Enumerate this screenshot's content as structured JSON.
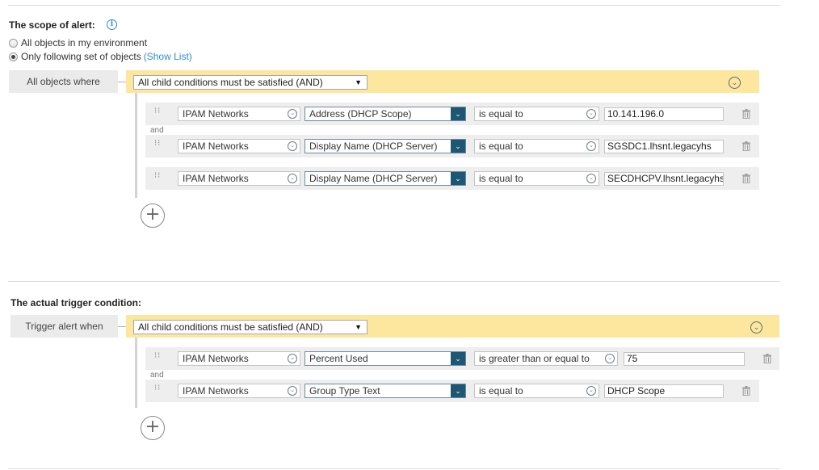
{
  "scope": {
    "heading": "The scope of alert:",
    "info_icon": "i",
    "radio_all": "All objects in my environment",
    "radio_following": "Only following set of objects",
    "show_list": "(Show List)",
    "label": "All objects where",
    "group_select": "All child conditions must be satisfied (AND)",
    "rows": [
      {
        "entity": "IPAM Networks",
        "field": "Address (DHCP Scope)",
        "operator": "is equal to",
        "value": "10.141.196.0"
      },
      {
        "entity": "IPAM Networks",
        "field": "Display Name (DHCP Server)",
        "operator": "is equal to",
        "value": "SGSDC1.lhsnt.legacyhs"
      },
      {
        "entity": "IPAM Networks",
        "field": "Display Name (DHCP Server)",
        "operator": "is equal to",
        "value": "SECDHCPV.lhsnt.legacyhs"
      }
    ],
    "and_label": "and"
  },
  "trigger": {
    "heading": "The actual trigger condition:",
    "label": "Trigger alert when",
    "group_select": "All child conditions must be satisfied (AND)",
    "rows": [
      {
        "entity": "IPAM Networks",
        "field": "Percent Used",
        "operator": "is greater than or equal to",
        "value": "75"
      },
      {
        "entity": "IPAM Networks",
        "field": "Group Type Text",
        "operator": "is equal to",
        "value": "DHCP Scope"
      }
    ],
    "and_label": "and"
  },
  "icons": {
    "add": "+",
    "collapse": "chevron-down-circle",
    "dropdown_triangle": "▼",
    "grip": "drag-handle"
  }
}
